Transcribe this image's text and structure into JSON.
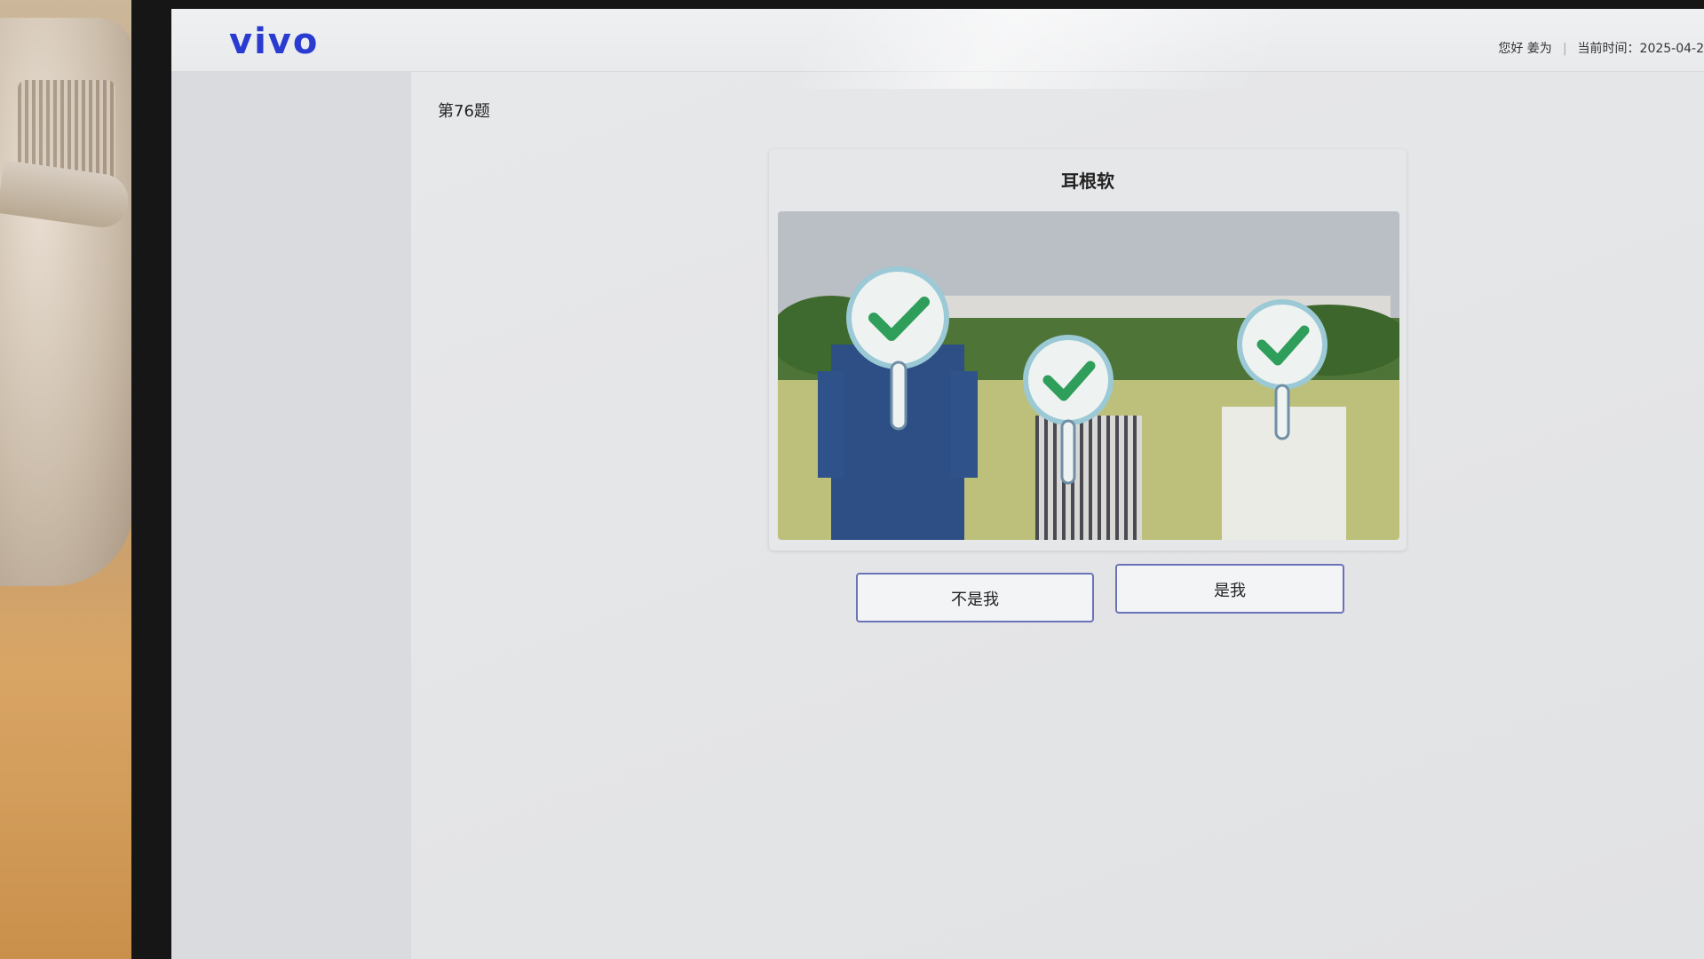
{
  "header": {
    "logo": "vivo",
    "greeting": "您好 姜为",
    "time_label": "当前时间：2025-04-2"
  },
  "question": {
    "number": "第76题",
    "title": "耳根软",
    "image_icon": "three-people-holding-checkmark-signs"
  },
  "actions": {
    "not_me": "不是我",
    "is_me": "是我"
  },
  "colors": {
    "brand": "#2a3bd1",
    "button_border": "#6b73b8",
    "check": "#2e9e5a"
  }
}
